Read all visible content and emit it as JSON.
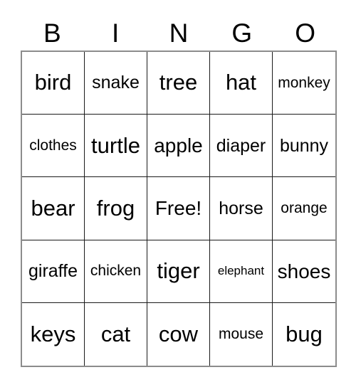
{
  "card": {
    "title": "Bingo Card",
    "background_color": "#ffffff",
    "text_color": "#000000",
    "outer_border_color": "#8c8c8c",
    "grid_line_color": "#1a1a1a"
  },
  "header": {
    "letters": [
      "B",
      "I",
      "N",
      "G",
      "O"
    ]
  },
  "grid": {
    "columns": 5,
    "rows": 5,
    "cells": [
      {
        "text": "bird",
        "size": "fs-xl"
      },
      {
        "text": "snake",
        "size": "fs-md"
      },
      {
        "text": "tree",
        "size": "fs-xl"
      },
      {
        "text": "hat",
        "size": "fs-xl"
      },
      {
        "text": "monkey",
        "size": "fs-sm"
      },
      {
        "text": "clothes",
        "size": "fs-sm"
      },
      {
        "text": "turtle",
        "size": "fs-xl"
      },
      {
        "text": "apple",
        "size": "fs-lg"
      },
      {
        "text": "diaper",
        "size": "fs-md"
      },
      {
        "text": "bunny",
        "size": "fs-md"
      },
      {
        "text": "bear",
        "size": "fs-xl"
      },
      {
        "text": "frog",
        "size": "fs-xl"
      },
      {
        "text": "Free!",
        "size": "fs-lg"
      },
      {
        "text": "horse",
        "size": "fs-md"
      },
      {
        "text": "orange",
        "size": "fs-sm"
      },
      {
        "text": "giraffe",
        "size": "fs-md"
      },
      {
        "text": "chicken",
        "size": "fs-sm"
      },
      {
        "text": "tiger",
        "size": "fs-xl"
      },
      {
        "text": "elephant",
        "size": "fs-xxs"
      },
      {
        "text": "shoes",
        "size": "fs-lg"
      },
      {
        "text": "keys",
        "size": "fs-xl"
      },
      {
        "text": "cat",
        "size": "fs-xl"
      },
      {
        "text": "cow",
        "size": "fs-xl"
      },
      {
        "text": "mouse",
        "size": "fs-sm"
      },
      {
        "text": "bug",
        "size": "fs-xl"
      }
    ]
  }
}
